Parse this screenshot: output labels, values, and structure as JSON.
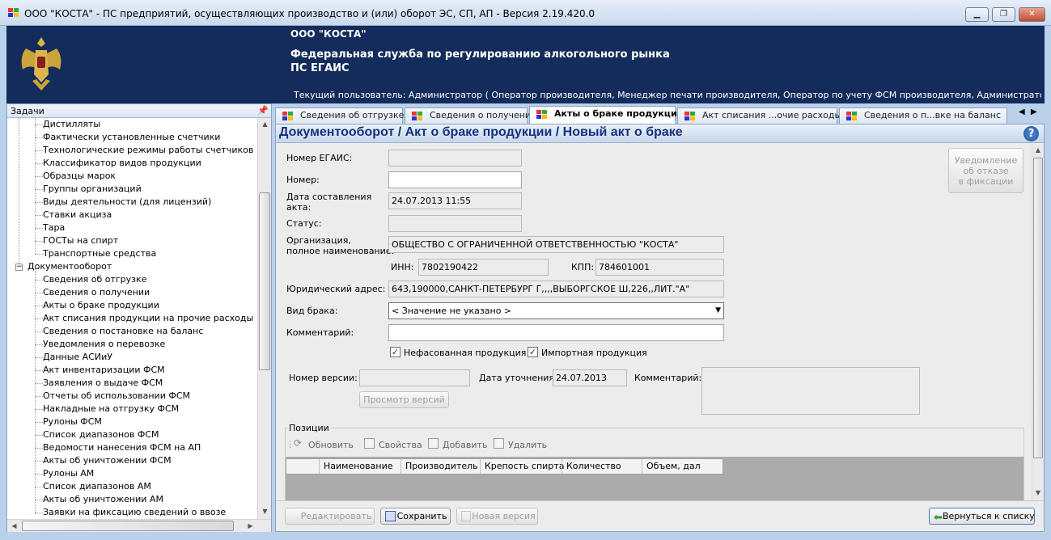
{
  "window": {
    "title": "ООО \"КОСТА\" - ПС предприятий, осуществляющих производство и (или) оборот ЭС, СП, АП - Версия 2.19.420.0"
  },
  "banner": {
    "org": "ООО \"КОСТА\"",
    "service_line1": "Федеральная служба по регулированию алкогольного рынка",
    "service_line2": "ПС ЕГАИС",
    "current_user": "Текущий пользователь: Администратор ( Оператор производителя, Менеджер печати производителя, Оператор по учету ФСМ производителя, Администратор производителя, Оп..."
  },
  "tasks": {
    "title": "Задачи",
    "items": [
      "Дистилляты",
      "Фактически установленные счетчики",
      "Технологические режимы работы счетчиков",
      "Классификатор видов продукции",
      "Образцы марок",
      "Группы организаций",
      "Виды деятельности (для лицензий)",
      "Ставки акциза",
      "Тара",
      "ГОСТы на спирт",
      "Транспортные средства"
    ],
    "group_docflow": "Документооборот",
    "docflow_items": [
      "Сведения об отгрузке",
      "Сведения о получении",
      "Акты о браке продукции",
      "Акт списания продукции на прочие расходы",
      "Сведения о постановке на баланс",
      "Уведомления о перевозке",
      "Данные АСИиУ",
      "Акт инвентаризации ФСМ",
      "Заявления о выдаче ФСМ",
      "Отчеты об использовании ФСМ",
      "Накладные на отгрузку ФСМ",
      "Рулоны ФСМ",
      "Список диапазонов ФСМ",
      "Ведомости нанесения ФСМ на АП",
      "Акты об уничтожении ФСМ",
      "Рулоны АМ",
      "Список диапазонов АМ",
      "Акты об уничтожении АМ",
      "Заявки на фиксацию сведений о ввозе"
    ]
  },
  "tabs": [
    {
      "label": "Сведения об отгрузке"
    },
    {
      "label": "Сведения о получении"
    },
    {
      "label": "Акты о браке продукции"
    },
    {
      "label": "Акт списания ...очие расходы"
    },
    {
      "label": "Сведения о п...вке на баланс"
    }
  ],
  "doc": {
    "title": "Документооборот / Акт о браке продукции / Новый акт о браке",
    "help_glyph": "?",
    "notify_button": [
      "Уведомление",
      "об отказе",
      "в фиксации"
    ],
    "labels": {
      "egais_number": "Номер ЕГАИС:",
      "number": "Номер:",
      "date_line1": "Дата составления",
      "date_line2": "акта:",
      "status": "Статус:",
      "org_line1": "Организация,",
      "org_line2": "полное наименование:",
      "inn": "ИНН:",
      "kpp": "КПП:",
      "address": "Юридический адрес:",
      "defect_type": "Вид брака:",
      "comment": "Комментарий:",
      "version_number": "Номер версии:",
      "refine_date": "Дата уточнения:",
      "version_comment": "Комментарий:"
    },
    "values": {
      "egais_number": "",
      "number": "",
      "date": "24.07.2013 11:55",
      "status": "",
      "org_name": "ОБЩЕСТВО С ОГРАНИЧЕННОЙ ОТВЕТСТВЕННОСТЬЮ \"КОСТА\"",
      "inn": "7802190422",
      "kpp": "784601001",
      "address": "643,190000,САНКТ-ПЕТЕРБУРГ Г,,,,ВЫБОРГСКОЕ Ш,226,,ЛИТ.\"А\"",
      "defect_type": "< Значение не указано >",
      "comment": "",
      "version_number": "",
      "refine_date": "24.07.2013",
      "version_comment": ""
    },
    "checkboxes": [
      {
        "label": "Нефасованная продукция",
        "checked": true
      },
      {
        "label": "Импортная продукция",
        "checked": true
      }
    ],
    "view_versions_button": "Просмотр версий",
    "positions": {
      "legend": "Позиции",
      "toolbar": [
        "Обновить",
        "Свойства",
        "Добавить",
        "Удалить"
      ],
      "columns": [
        "Наименование",
        "Производитель",
        "Крепость спирта",
        "Количество",
        "Объем, дал"
      ]
    },
    "bottom_buttons": {
      "edit": "Редактировать",
      "save": "Сохранить",
      "new_version": "Новая версия",
      "back": "Вернуться к списку"
    }
  }
}
